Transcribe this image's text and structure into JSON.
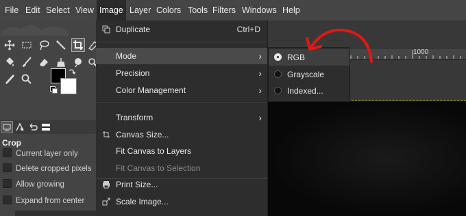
{
  "menubar": {
    "items": [
      {
        "label": "File"
      },
      {
        "label": "Edit"
      },
      {
        "label": "Select"
      },
      {
        "label": "View"
      },
      {
        "label": "Image"
      },
      {
        "label": "Layer"
      },
      {
        "label": "Colors"
      },
      {
        "label": "Tools"
      },
      {
        "label": "Filters"
      },
      {
        "label": "Windows"
      },
      {
        "label": "Help"
      }
    ],
    "active": "Image"
  },
  "image_menu": {
    "items": [
      {
        "label": "Duplicate",
        "accel": "Ctrl+D",
        "icon": "duplicate-icon"
      },
      {
        "label": "Mode",
        "submenu": true
      },
      {
        "label": "Precision",
        "submenu": true
      },
      {
        "label": "Color Management",
        "submenu": true
      },
      {
        "label": "Transform",
        "submenu": true
      },
      {
        "label": "Canvas Size...",
        "icon": "canvas-size-icon"
      },
      {
        "label": "Fit Canvas to Layers"
      },
      {
        "label": "Fit Canvas to Selection",
        "disabled": true
      },
      {
        "label": "Print Size...",
        "icon": "print-icon"
      },
      {
        "label": "Scale Image...",
        "icon": "scale-icon"
      }
    ]
  },
  "mode_menu": {
    "items": [
      {
        "label": "RGB",
        "selected": true
      },
      {
        "label": "Grayscale",
        "selected": false
      },
      {
        "label": "Indexed...",
        "selected": false
      }
    ]
  },
  "tool_options": {
    "title": "Crop",
    "options": [
      {
        "label": "Current layer only",
        "checked": false
      },
      {
        "label": "Delete cropped pixels",
        "checked": false
      },
      {
        "label": "Allow growing",
        "checked": false
      },
      {
        "label": "Expand from center",
        "checked": false
      }
    ]
  },
  "ruler": {
    "label": "1000"
  },
  "colors": {
    "foreground": "#000000",
    "background": "#ffffff",
    "annotation": "#e01818",
    "selection": "#c9b400"
  }
}
